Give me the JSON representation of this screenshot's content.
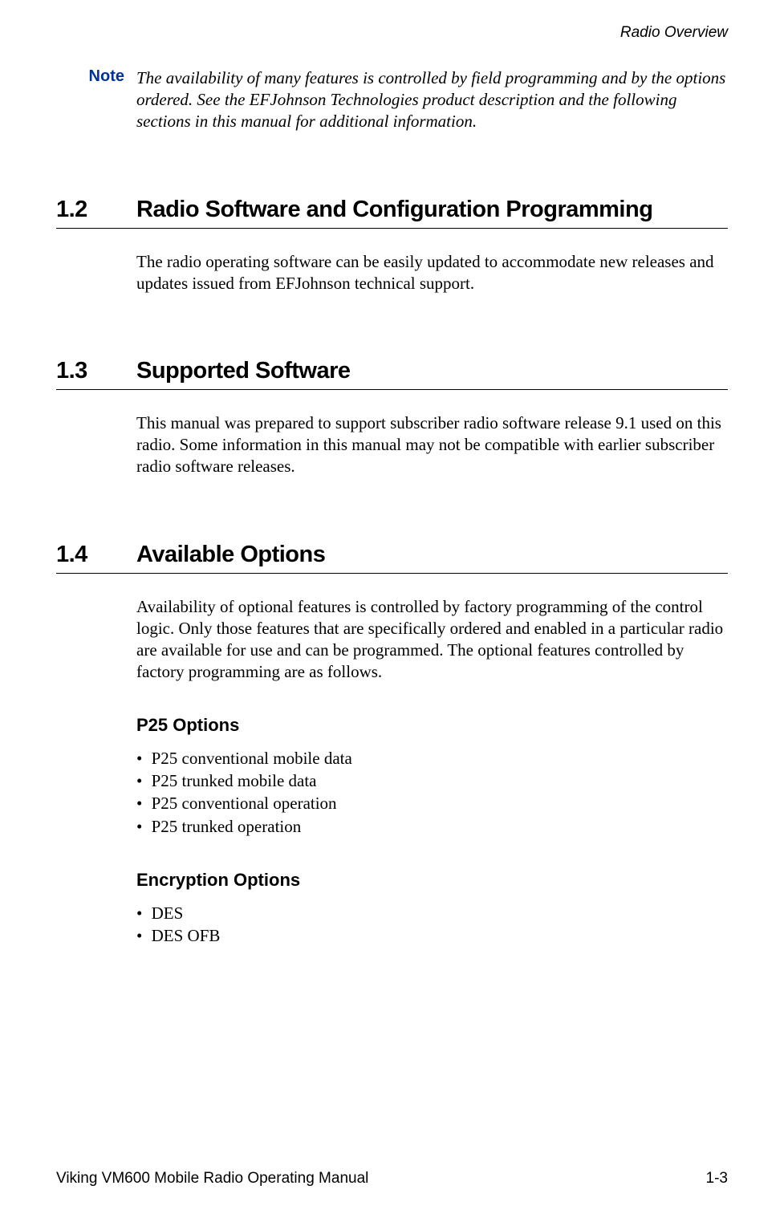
{
  "header": {
    "running_title": "Radio Overview"
  },
  "note": {
    "label": "Note",
    "text": "The availability of many features is controlled by field programming and by the options ordered. See the EFJohnson Technologies product description and the following sections in this manual for additional information."
  },
  "sections": [
    {
      "number": "1.2",
      "title": "Radio Software and Configuration Programming",
      "body": "The radio operating software can be easily updated to accommodate new releases and updates issued from EFJohnson technical support."
    },
    {
      "number": "1.3",
      "title": "Supported Software",
      "body": "This manual was prepared to support subscriber radio software release 9.1 used on this radio. Some information in this manual may not be compatible with earlier subscriber radio software releases."
    },
    {
      "number": "1.4",
      "title": "Available Options",
      "body": "Availability of optional features is controlled by factory programming of the control logic. Only those features that are specifically ordered and enabled in a particular radio are available for use and can be programmed. The optional features controlled by factory programming are as follows.",
      "subsections": [
        {
          "heading": "P25 Options",
          "items": [
            "P25 conventional mobile data",
            "P25 trunked mobile data",
            "P25 conventional operation",
            "P25 trunked operation"
          ]
        },
        {
          "heading": "Encryption Options",
          "items": [
            "DES",
            "DES OFB"
          ]
        }
      ]
    }
  ],
  "footer": {
    "left": "Viking VM600 Mobile Radio Operating Manual",
    "right": "1-3"
  }
}
